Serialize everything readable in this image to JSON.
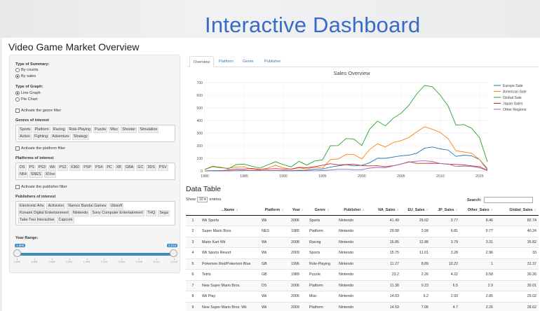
{
  "banner": {
    "title": "Interactive Dashboard"
  },
  "app": {
    "title": "Video Game Market Overview"
  },
  "sidebar": {
    "summary_label": "Type of Summary:",
    "summary_options": [
      "By counts",
      "By sales"
    ],
    "summary_selected": "By sales",
    "graph_label": "Type of Graph:",
    "graph_options": [
      "Line Graph",
      "Pie Chart"
    ],
    "graph_selected": "Line Graph",
    "genre_filter_label": "Activate the genre filter",
    "genres_label": "Genres of interest",
    "genres": [
      "Sports",
      "Platform",
      "Racing",
      "Role-Playing",
      "Puzzle",
      "Misc",
      "Shooter",
      "Simulation",
      "Action",
      "Fighting",
      "Adventure",
      "Strategy"
    ],
    "platform_filter_label": "Activate the platform filter",
    "platforms_label": "Platforms of interest",
    "platforms": [
      "DS",
      "PS",
      "PS3",
      "Wii",
      "PS2",
      "X360",
      "PSP",
      "PS4",
      "PC",
      "XB",
      "GBA",
      "GC",
      "3DS",
      "PSV",
      "N64",
      "SNES",
      "XOne"
    ],
    "publisher_filter_label": "Activate the publisher filter",
    "publishers_label": "Publishers of interest",
    "publishers": [
      "Electronic Arts",
      "Activision",
      "Namco Bandai Games",
      "Ubisoft",
      "Konami Digital Entertainment",
      "Nintendo",
      "Sony Computer Entertainment",
      "THQ",
      "Sega",
      "Take-Two Interactive",
      "Capcom"
    ],
    "year_label": "Year Range:",
    "year_min": "1,980",
    "year_max": "2,016",
    "year_range_selected": [
      1980,
      2016
    ],
    "year_ticks": [
      "1,980",
      "1,984",
      "1,988",
      "1,992",
      "1,996",
      "2,000",
      "2,004",
      "2,008",
      "2,012",
      "2,016"
    ]
  },
  "tabs": [
    "Overview",
    "Platform",
    "Genre",
    "Publisher"
  ],
  "active_tab": "Overview",
  "chart_data": {
    "type": "line",
    "title": "Sales Overview",
    "xlabel": "",
    "ylabel": "",
    "xlim": [
      1980,
      2016
    ],
    "ylim": [
      0,
      700
    ],
    "x_ticks": [
      1980,
      1985,
      1990,
      1995,
      2000,
      2005,
      2010,
      2015
    ],
    "y_ticks": [
      0,
      100,
      200,
      300,
      400,
      500,
      600,
      700
    ],
    "x": [
      1980,
      1981,
      1982,
      1983,
      1984,
      1985,
      1986,
      1987,
      1988,
      1989,
      1990,
      1991,
      1992,
      1993,
      1994,
      1995,
      1996,
      1997,
      1998,
      1999,
      2000,
      2001,
      2002,
      2003,
      2004,
      2005,
      2006,
      2007,
      2008,
      2009,
      2010,
      2011,
      2012,
      2013,
      2014,
      2015,
      2016
    ],
    "legend_position": "top-right",
    "grid": true,
    "series": [
      {
        "name": "Europe Sale",
        "color": "#1f77b4",
        "values": [
          1,
          2,
          3,
          1,
          2,
          5,
          3,
          2,
          3,
          2,
          4,
          3,
          5,
          5,
          14,
          15,
          30,
          40,
          50,
          40,
          45,
          65,
          100,
          100,
          110,
          120,
          125,
          140,
          180,
          190,
          175,
          165,
          115,
          125,
          120,
          90,
          10
        ]
      },
      {
        "name": "American Sale",
        "color": "#ff7f0e",
        "values": [
          11,
          33,
          25,
          21,
          31,
          33,
          12,
          8,
          22,
          45,
          25,
          13,
          25,
          15,
          30,
          21,
          90,
          95,
          130,
          130,
          95,
          170,
          215,
          190,
          225,
          240,
          265,
          310,
          350,
          330,
          305,
          255,
          160,
          150,
          140,
          90,
          20
        ]
      },
      {
        "name": "Global Sale",
        "color": "#2ca02c",
        "values": [
          12,
          36,
          29,
          17,
          50,
          54,
          37,
          22,
          47,
          73,
          50,
          32,
          76,
          46,
          79,
          88,
          200,
          201,
          257,
          252,
          201,
          331,
          395,
          357,
          418,
          457,
          521,
          611,
          678,
          667,
          600,
          515,
          363,
          368,
          338,
          264,
          71
        ]
      },
      {
        "name": "Japan Sales",
        "color": "#d62728",
        "values": [
          0,
          0,
          0,
          8,
          14,
          15,
          20,
          11,
          15,
          18,
          15,
          15,
          28,
          25,
          33,
          45,
          57,
          48,
          50,
          52,
          42,
          40,
          41,
          34,
          41,
          54,
          73,
          60,
          60,
          61,
          59,
          53,
          51,
          47,
          40,
          34,
          5
        ]
      },
      {
        "name": "Other Regions",
        "color": "#9467bd",
        "values": [
          0,
          0,
          0,
          1,
          1,
          2,
          2,
          2,
          2,
          2,
          1,
          1,
          1,
          1,
          1,
          3,
          7,
          13,
          13,
          10,
          10,
          22,
          28,
          25,
          40,
          55,
          70,
          77,
          80,
          75,
          58,
          55,
          35,
          38,
          35,
          25,
          3
        ]
      }
    ]
  },
  "table": {
    "title": "Data Table",
    "show_label": "Show",
    "entries_value": "10",
    "entries_label": "entries",
    "search_label": "Search:",
    "columns": [
      "",
      "...Name",
      "Platform",
      "Year",
      "Genre",
      "Publisher",
      "NA_Sales",
      "EU_Sales",
      "JP_Sales",
      "Other_Sales",
      "Global_Sales"
    ],
    "rows": [
      [
        "1",
        "Wii Sports",
        "Wii",
        "2006",
        "Sports",
        "Nintendo",
        "41.49",
        "29.02",
        "3.77",
        "8.46",
        "82.74"
      ],
      [
        "2",
        "Super Mario Bros.",
        "NES",
        "1985",
        "Platform",
        "Nintendo",
        "29.08",
        "3.58",
        "6.81",
        "0.77",
        "40.24"
      ],
      [
        "3",
        "Mario Kart Wii",
        "Wii",
        "2008",
        "Racing",
        "Nintendo",
        "15.85",
        "12.88",
        "3.79",
        "3.31",
        "35.82"
      ],
      [
        "4",
        "Wii Sports Resort",
        "Wii",
        "2009",
        "Sports",
        "Nintendo",
        "15.75",
        "11.01",
        "3.28",
        "2.96",
        "33"
      ],
      [
        "5",
        "Pokemon Red/Pokemon Blue",
        "GB",
        "1996",
        "Role-Playing",
        "Nintendo",
        "11.27",
        "8.89",
        "10.22",
        "1",
        "31.37"
      ],
      [
        "6",
        "Tetris",
        "GB",
        "1989",
        "Puzzle",
        "Nintendo",
        "23.2",
        "2.26",
        "4.22",
        "0.58",
        "30.26"
      ],
      [
        "7",
        "New Super Mario Bros.",
        "DS",
        "2006",
        "Platform",
        "Nintendo",
        "11.38",
        "9.23",
        "6.5",
        "2.9",
        "30.01"
      ],
      [
        "8",
        "Wii Play",
        "Wii",
        "2006",
        "Misc",
        "Nintendo",
        "14.03",
        "9.2",
        "2.93",
        "2.85",
        "29.02"
      ],
      [
        "9",
        "New Super Mario Bros. Wii",
        "Wii",
        "2009",
        "Platform",
        "Nintendo",
        "14.59",
        "7.06",
        "4.7",
        "2.26",
        "28.62"
      ]
    ]
  }
}
